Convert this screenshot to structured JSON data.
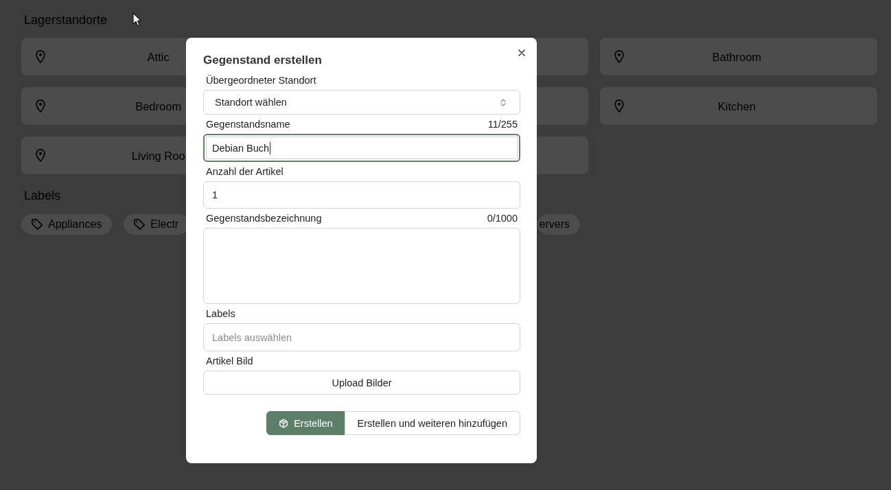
{
  "page": {
    "title": "Lagerstandorte",
    "locations": [
      {
        "kind": "whole",
        "label": "Attic"
      },
      {
        "kind": "covered"
      },
      {
        "kind": "whole",
        "label": "Bathroom"
      },
      {
        "kind": "whole",
        "label": "Bedroom"
      },
      {
        "kind": "covered"
      },
      {
        "kind": "whole",
        "label": "Kitchen"
      },
      {
        "kind": "whole",
        "label": "Living Roo"
      },
      {
        "kind": "covered"
      }
    ],
    "labels_title": "Labels",
    "tags": [
      {
        "kind": "whole",
        "label": "Appliances"
      },
      {
        "kind": "whole",
        "label": "Electr"
      },
      {
        "kind": "left_covered",
        "label": "ervers"
      }
    ]
  },
  "dialog": {
    "title": "Gegenstand erstellen",
    "fields": [
      {
        "kind": "select",
        "label": "Übergeordneter Standort",
        "value": "Standort wählen"
      },
      {
        "kind": "text",
        "label": "Gegenstandsname",
        "counter": "11/255",
        "value": "Debian Buch",
        "focused": true
      },
      {
        "kind": "text",
        "label": "Anzahl der Artikel",
        "value": "1",
        "focused": false
      },
      {
        "kind": "textarea",
        "label": "Gegenstandsbezeichnung",
        "counter": "0/1000"
      },
      {
        "kind": "multiselect",
        "label": "Labels",
        "placeholder": "Labels auswählen"
      },
      {
        "kind": "upload",
        "label": "Artikel Bild",
        "button": "Upload Bilder"
      }
    ],
    "actions": [
      {
        "label": "Erstellen",
        "primary": true
      },
      {
        "label": "Erstellen und weiteren hinzufügen",
        "primary": false
      }
    ]
  }
}
